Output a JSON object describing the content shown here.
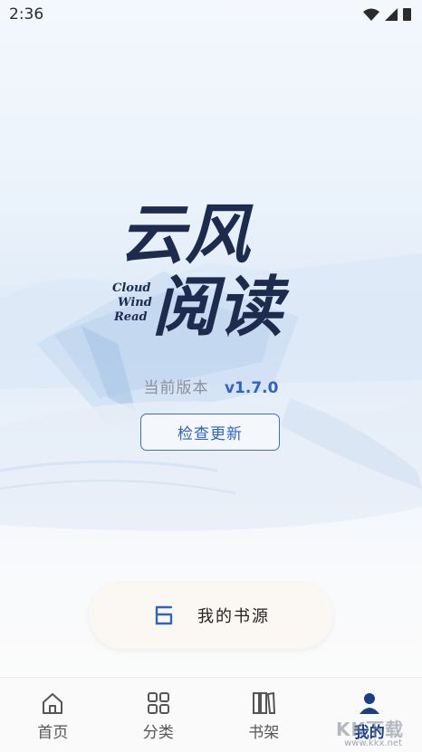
{
  "status_bar": {
    "time": "2:36"
  },
  "logo": {
    "chinese_line1": "云风",
    "chinese_line2": "阅读",
    "english_lines": [
      "Cloud",
      "Wind",
      "Read"
    ]
  },
  "version": {
    "label": "当前版本",
    "value": "v1.7.0"
  },
  "update_button": {
    "label": "检查更新"
  },
  "source_button": {
    "label": "我的书源"
  },
  "tabs": [
    {
      "label": "首页",
      "icon": "home-icon",
      "active": false
    },
    {
      "label": "分类",
      "icon": "grid-icon",
      "active": false
    },
    {
      "label": "书架",
      "icon": "bookshelf-icon",
      "active": false
    },
    {
      "label": "我的",
      "icon": "person-icon",
      "active": true
    }
  ],
  "watermark": {
    "text": "KK下载",
    "url": "www.kkx.net"
  },
  "colors": {
    "accent": "#2f63c6",
    "active_tab": "#1a3f88",
    "text_gray": "#8a8f98"
  }
}
